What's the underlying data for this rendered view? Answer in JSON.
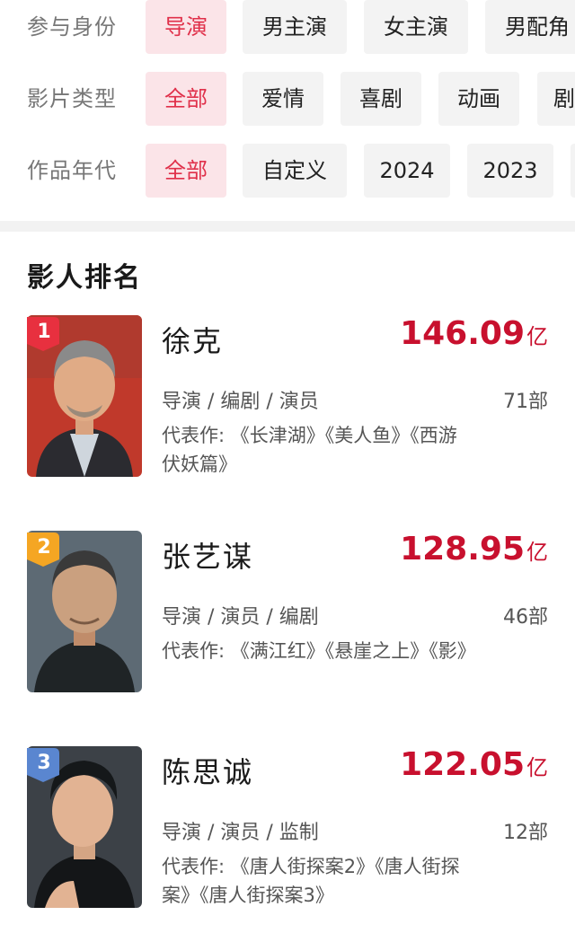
{
  "filters": [
    {
      "label": "参与身份",
      "chips": [
        {
          "text": "导演",
          "active": true
        },
        {
          "text": "男主演",
          "active": false
        },
        {
          "text": "女主演",
          "active": false
        },
        {
          "text": "男配角",
          "active": false
        }
      ]
    },
    {
      "label": "影片类型",
      "chips": [
        {
          "text": "全部",
          "active": true
        },
        {
          "text": "爱情",
          "active": false
        },
        {
          "text": "喜剧",
          "active": false
        },
        {
          "text": "动画",
          "active": false
        },
        {
          "text": "剧",
          "active": false
        }
      ]
    },
    {
      "label": "作品年代",
      "chips": [
        {
          "text": "全部",
          "active": true
        },
        {
          "text": "自定义",
          "active": false
        },
        {
          "text": "2024",
          "active": false
        },
        {
          "text": "2023",
          "active": false
        },
        {
          "text": "",
          "active": false
        }
      ]
    }
  ],
  "ranking": {
    "title": "影人排名",
    "people": [
      {
        "rank": "1",
        "name": "徐克",
        "gross": "146.09",
        "unit": "亿",
        "roles": "导演 / 编剧 / 演员",
        "count": "71部",
        "works": "代表作: 《长津湖》《美人鱼》《西游伏妖篇》"
      },
      {
        "rank": "2",
        "name": "张艺谋",
        "gross": "128.95",
        "unit": "亿",
        "roles": "导演 / 演员 / 编剧",
        "count": "46部",
        "works": "代表作: 《满江红》《悬崖之上》《影》"
      },
      {
        "rank": "3",
        "name": "陈思诚",
        "gross": "122.05",
        "unit": "亿",
        "roles": "导演 / 演员 / 监制",
        "count": "12部",
        "works": "代表作: 《唐人街探案2》《唐人街探案》《唐人街探案3》"
      }
    ]
  },
  "colors": {
    "accent": "#c8102e",
    "chip_active_bg": "#fbe4e8",
    "chip_active_text": "#e0304a",
    "badge_gold": "#e8303f",
    "badge_orange": "#f5a623",
    "badge_blue": "#5a86d0"
  }
}
